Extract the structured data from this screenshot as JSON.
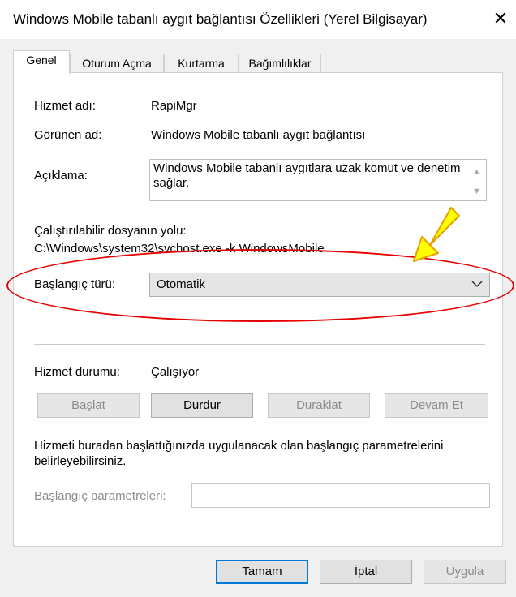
{
  "window": {
    "title": "Windows Mobile tabanlı aygıt bağlantısı Özellikleri (Yerel Bilgisayar)",
    "close": "✕"
  },
  "tabs": [
    {
      "label": "Genel"
    },
    {
      "label": "Oturum Açma"
    },
    {
      "label": "Kurtarma"
    },
    {
      "label": "Bağımlılıklar"
    }
  ],
  "general": {
    "service_name_label": "Hizmet adı:",
    "service_name_value": "RapiMgr",
    "display_name_label": "Görünen ad:",
    "display_name_value": "Windows Mobile tabanlı aygıt bağlantısı",
    "description_label": "Açıklama:",
    "description_value": "Windows Mobile tabanlı aygıtlara uzak komut ve denetim sağlar.",
    "exe_path_label": "Çalıştırılabilir dosyanın yolu:",
    "exe_path_value": "C:\\Windows\\system32\\svchost.exe -k WindowsMobile",
    "startup_type_label": "Başlangıç türü:",
    "startup_type_value": "Otomatik",
    "status_label": "Hizmet durumu:",
    "status_value": "Çalışıyor",
    "buttons": {
      "start": "Başlat",
      "stop": "Durdur",
      "pause": "Duraklat",
      "resume": "Devam Et"
    },
    "info_text": "Hizmeti buradan başlattığınızda uygulanacak olan başlangıç parametrelerini belirleyebilirsiniz.",
    "start_params_label": "Başlangıç parametreleri:",
    "start_params_value": ""
  },
  "footer": {
    "ok": "Tamam",
    "cancel": "İptal",
    "apply": "Uygula"
  },
  "annotation_colors": {
    "ellipse": "#e60000",
    "arrow_fill": "#ffff00",
    "arrow_stroke": "#e6a000"
  }
}
